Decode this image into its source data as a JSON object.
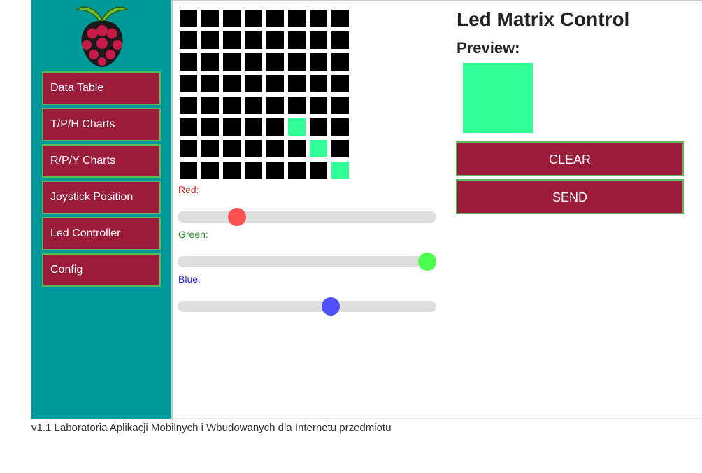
{
  "colors": {
    "sidebar_bg": "#009999",
    "nav_bg": "#9b1b3b",
    "nav_border": "#5cb85c",
    "led_off": "#000000",
    "led_on": "#33ff99",
    "red_label": "#e02020",
    "green_label": "#2a8a2a",
    "blue_label": "#2a2ad0",
    "red_thumb": "#ff5050",
    "green_thumb": "#4cff4c",
    "blue_thumb": "#5050ff"
  },
  "sidebar": {
    "logo_icon": "raspberry-pi-logo-icon",
    "items": [
      {
        "label": "Data Table"
      },
      {
        "label": "T/P/H Charts"
      },
      {
        "label": "R/P/Y Charts"
      },
      {
        "label": "Joystick Position"
      },
      {
        "label": "Led Controller"
      },
      {
        "label": "Config"
      }
    ]
  },
  "matrix": {
    "rows": 8,
    "cols": 8,
    "lit": [
      [
        5,
        5
      ],
      [
        6,
        6
      ],
      [
        7,
        7
      ]
    ]
  },
  "sliders": {
    "red": {
      "label": "Red:",
      "value": 0.21
    },
    "green": {
      "label": "Green:",
      "value": 1.0
    },
    "blue": {
      "label": "Blue:",
      "value": 0.6
    }
  },
  "panel": {
    "title": "Led Matrix Control",
    "preview_label": "Preview:",
    "preview_color": "#33ff99",
    "clear_label": "CLEAR",
    "send_label": "SEND"
  },
  "footer": {
    "text": "v1.1 Laboratoria Aplikacji Mobilnych i Wbudowanych dla Internetu przedmiotu"
  }
}
